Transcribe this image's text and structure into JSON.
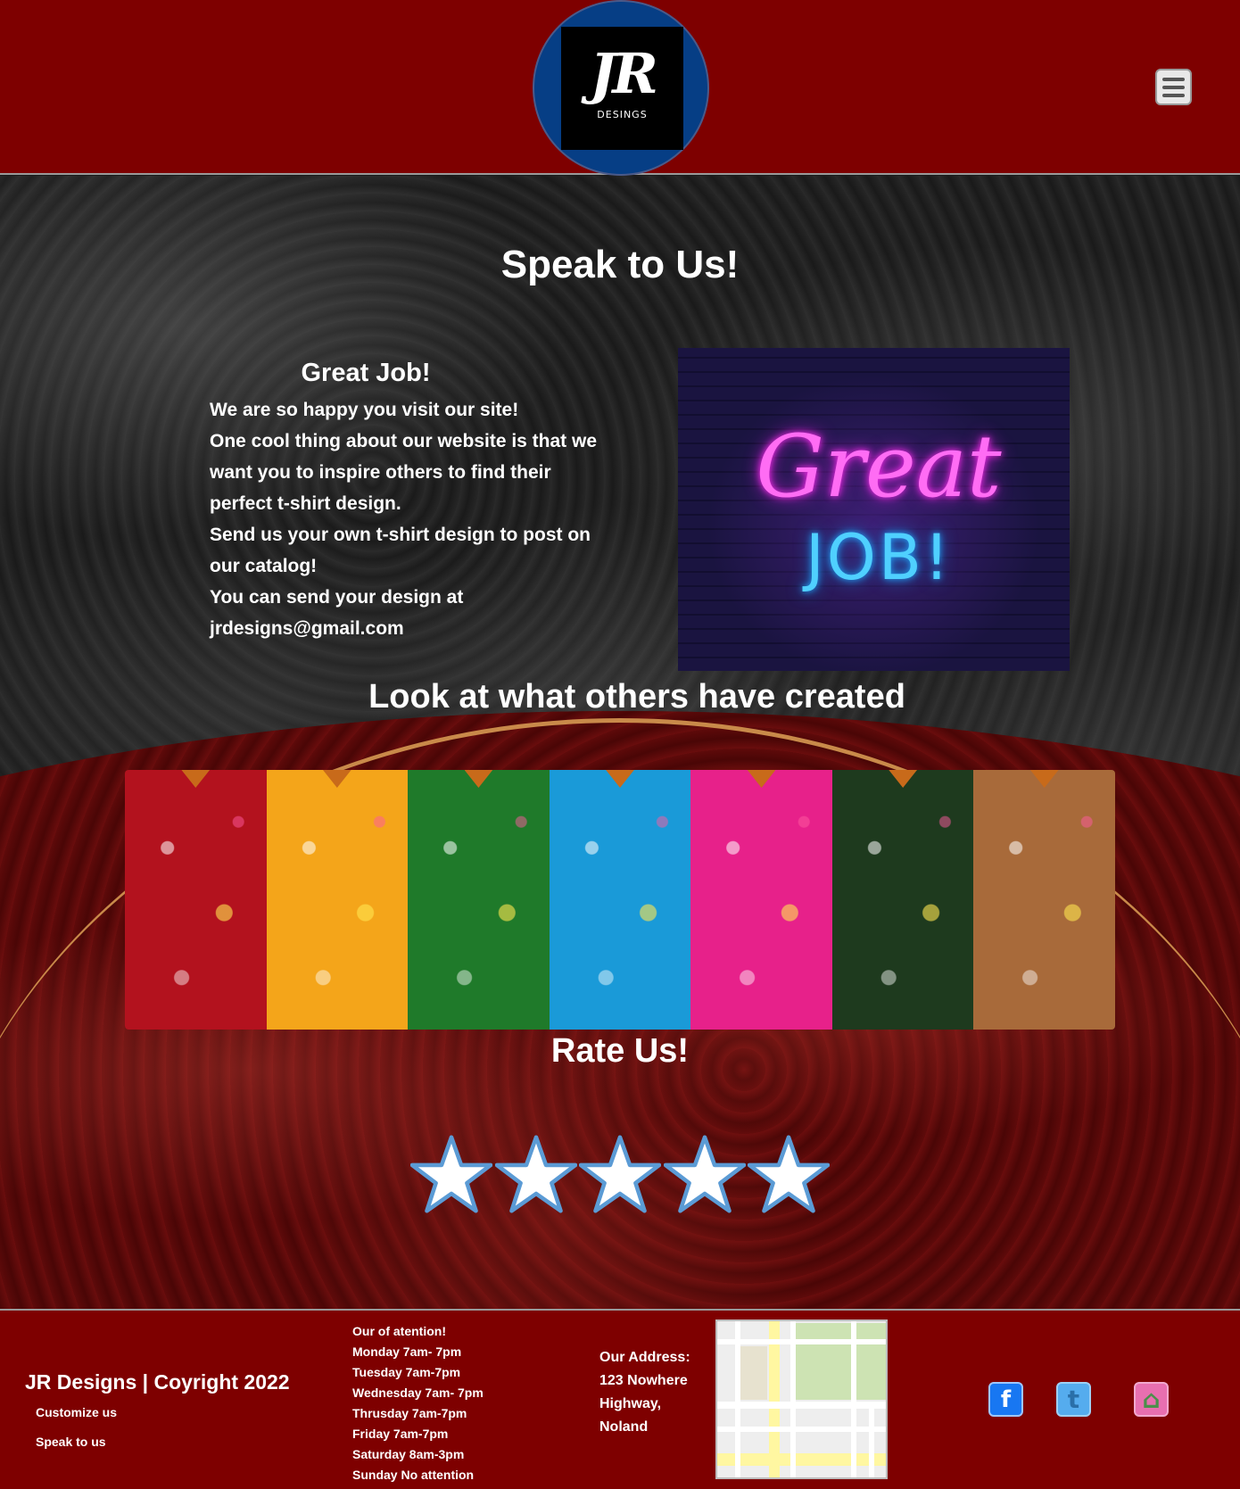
{
  "header": {
    "logo_mark": "JR",
    "logo_sub": "DESINGS",
    "menu_icon": "hamburger-menu-icon"
  },
  "speak_section": {
    "title": "Speak to Us!",
    "card_title": "Great Job!",
    "paragraphs": [
      "We are so happy you visit our site!",
      "One cool thing about our website is that we want you to inspire others to find their perfect t-shirt design.",
      "Send us your own t-shirt design to post on our catalog!",
      "You can send your design at jrdesigns@gmail.com"
    ],
    "image_text_top": "Great",
    "image_text_bottom": "JOB!"
  },
  "gallery": {
    "title": "Look at what others have created",
    "shirt_colors": [
      "#b3121e",
      "#f4a51a",
      "#1f7a2a",
      "#1a9ad8",
      "#e7218a",
      "#1e3a1e",
      "#a86a3a"
    ]
  },
  "rating": {
    "title": "Rate Us!",
    "stars_total": 5
  },
  "footer": {
    "copyright": "JR Designs | Coyright 2022",
    "links": [
      "Customize us",
      "Speak to us"
    ],
    "hours": [
      "Our of atention!",
      "Monday 7am- 7pm",
      "Tuesday 7am-7pm",
      "Wednesday 7am- 7pm",
      "Thrusday 7am-7pm",
      "Friday 7am-7pm",
      "Saturday 8am-3pm",
      "Sunday No attention"
    ],
    "address": [
      "Our Address:",
      "123 Nowhere",
      "Highway,",
      "Noland"
    ],
    "social": {
      "facebook_glyph": "f",
      "twitter_glyph": "t",
      "home_glyph": "⌂"
    },
    "colors": {
      "facebook": "#1877f2",
      "twitter": "#55acee",
      "home": "#e86fb0"
    }
  },
  "colors": {
    "brand_red": "#7e0000",
    "logo_blue": "#063e85",
    "star_blue": "#5b9bd5"
  }
}
